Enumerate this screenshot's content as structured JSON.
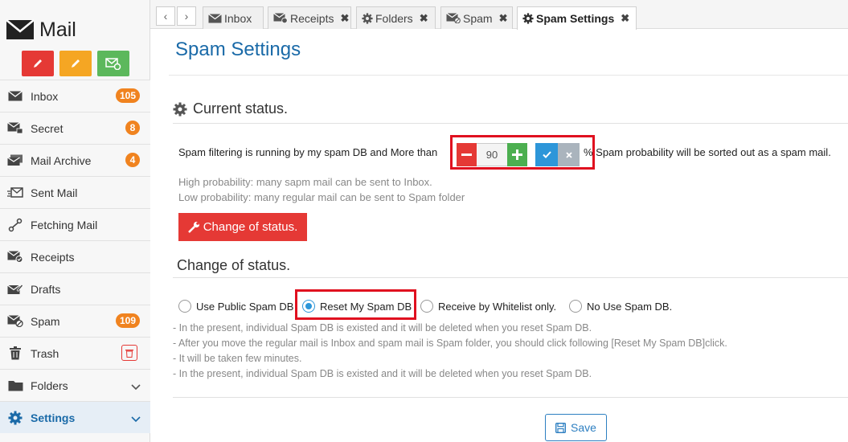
{
  "app": {
    "name": "Mail"
  },
  "sidebar": {
    "items": [
      {
        "label": "Inbox",
        "badge": "105"
      },
      {
        "label": "Secret",
        "badge": "8"
      },
      {
        "label": "Mail Archive",
        "badge": "4"
      },
      {
        "label": "Sent Mail"
      },
      {
        "label": "Fetching Mail"
      },
      {
        "label": "Receipts"
      },
      {
        "label": "Drafts"
      },
      {
        "label": "Spam",
        "badge": "109"
      },
      {
        "label": "Trash"
      },
      {
        "label": "Folders"
      },
      {
        "label": "Settings"
      }
    ]
  },
  "tabs": [
    {
      "label": "Inbox",
      "icon": "envelope-icon"
    },
    {
      "label": "Receipts",
      "icon": "envelope-check-icon"
    },
    {
      "label": "Folders",
      "icon": "gear-icon"
    },
    {
      "label": "Spam",
      "icon": "spam-icon"
    },
    {
      "label": "Spam Settings",
      "icon": "gear-icon",
      "active": true
    }
  ],
  "main": {
    "title": "Spam Settings",
    "current_status": {
      "heading": "Current status.",
      "text_before": "Spam filtering is running by my spam DB and More than",
      "text_after": "% Spam probability will be sorted out as a spam mail.",
      "threshold_value": "90",
      "hint_high": "High probability: many sapm mail can be sent to Inbox.",
      "hint_low": "Low probability: many regular mail can be sent to Spam folder",
      "change_button": "Change of status."
    },
    "change_status": {
      "heading": "Change of status.",
      "options": [
        {
          "label": "Use Public Spam DB",
          "checked": false
        },
        {
          "label": "Reset My Spam DB",
          "checked": true
        },
        {
          "label": "Receive by Whitelist only.",
          "checked": false
        },
        {
          "label": "No Use Spam DB.",
          "checked": false
        }
      ],
      "notes": [
        "- In the present, individual Spam DB is existed and it will be deleted when you reset Spam DB.",
        "- After you move the regular mail is Inbox and spam mail is Spam folder, you should click following [Reset My Spam DB]click.",
        "- It will be taken few minutes.",
        "- In the present, individual Spam DB is existed and it will be deleted when you reset Spam DB."
      ]
    },
    "save_label": "Save"
  },
  "colors": {
    "accent": "#1a6aa8",
    "danger": "#e53935",
    "badge": "#f0831f",
    "highlight_box": "#e0101f"
  }
}
